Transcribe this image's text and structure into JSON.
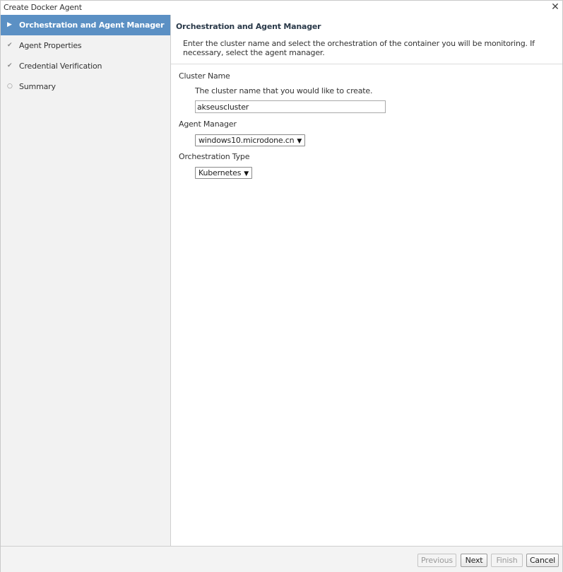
{
  "window": {
    "title": "Create Docker Agent",
    "close_glyph": "✕"
  },
  "steps": [
    {
      "label": "Orchestration and Agent Manager",
      "state": "active",
      "icon": "triangle-right-icon",
      "glyph": "▶"
    },
    {
      "label": "Agent Properties",
      "state": "done",
      "icon": "checkmark-icon",
      "glyph": "✔"
    },
    {
      "label": "Credential Verification",
      "state": "done",
      "icon": "checkmark-icon",
      "glyph": "✔"
    },
    {
      "label": "Summary",
      "state": "pending",
      "icon": "circle-icon",
      "glyph": "○"
    }
  ],
  "main": {
    "heading": "Orchestration and Agent Manager",
    "description": "Enter the cluster name and select the orchestration of the container you will be monitoring. If necessary, select the agent manager.",
    "cluster": {
      "label": "Cluster Name",
      "help": "The cluster name that you would like to create.",
      "value": "akseuscluster"
    },
    "agent_manager": {
      "label": "Agent Manager",
      "selected": "windows10.microdone.cn",
      "caret": "▼"
    },
    "orchestration": {
      "label": "Orchestration Type",
      "selected": "Kubernetes",
      "caret": "▼"
    }
  },
  "footer": {
    "previous": "Previous",
    "next": "Next",
    "finish": "Finish",
    "cancel": "Cancel"
  },
  "colors": {
    "active_step_bg": "#5b90c4",
    "sidebar_bg": "#f2f2f2"
  }
}
